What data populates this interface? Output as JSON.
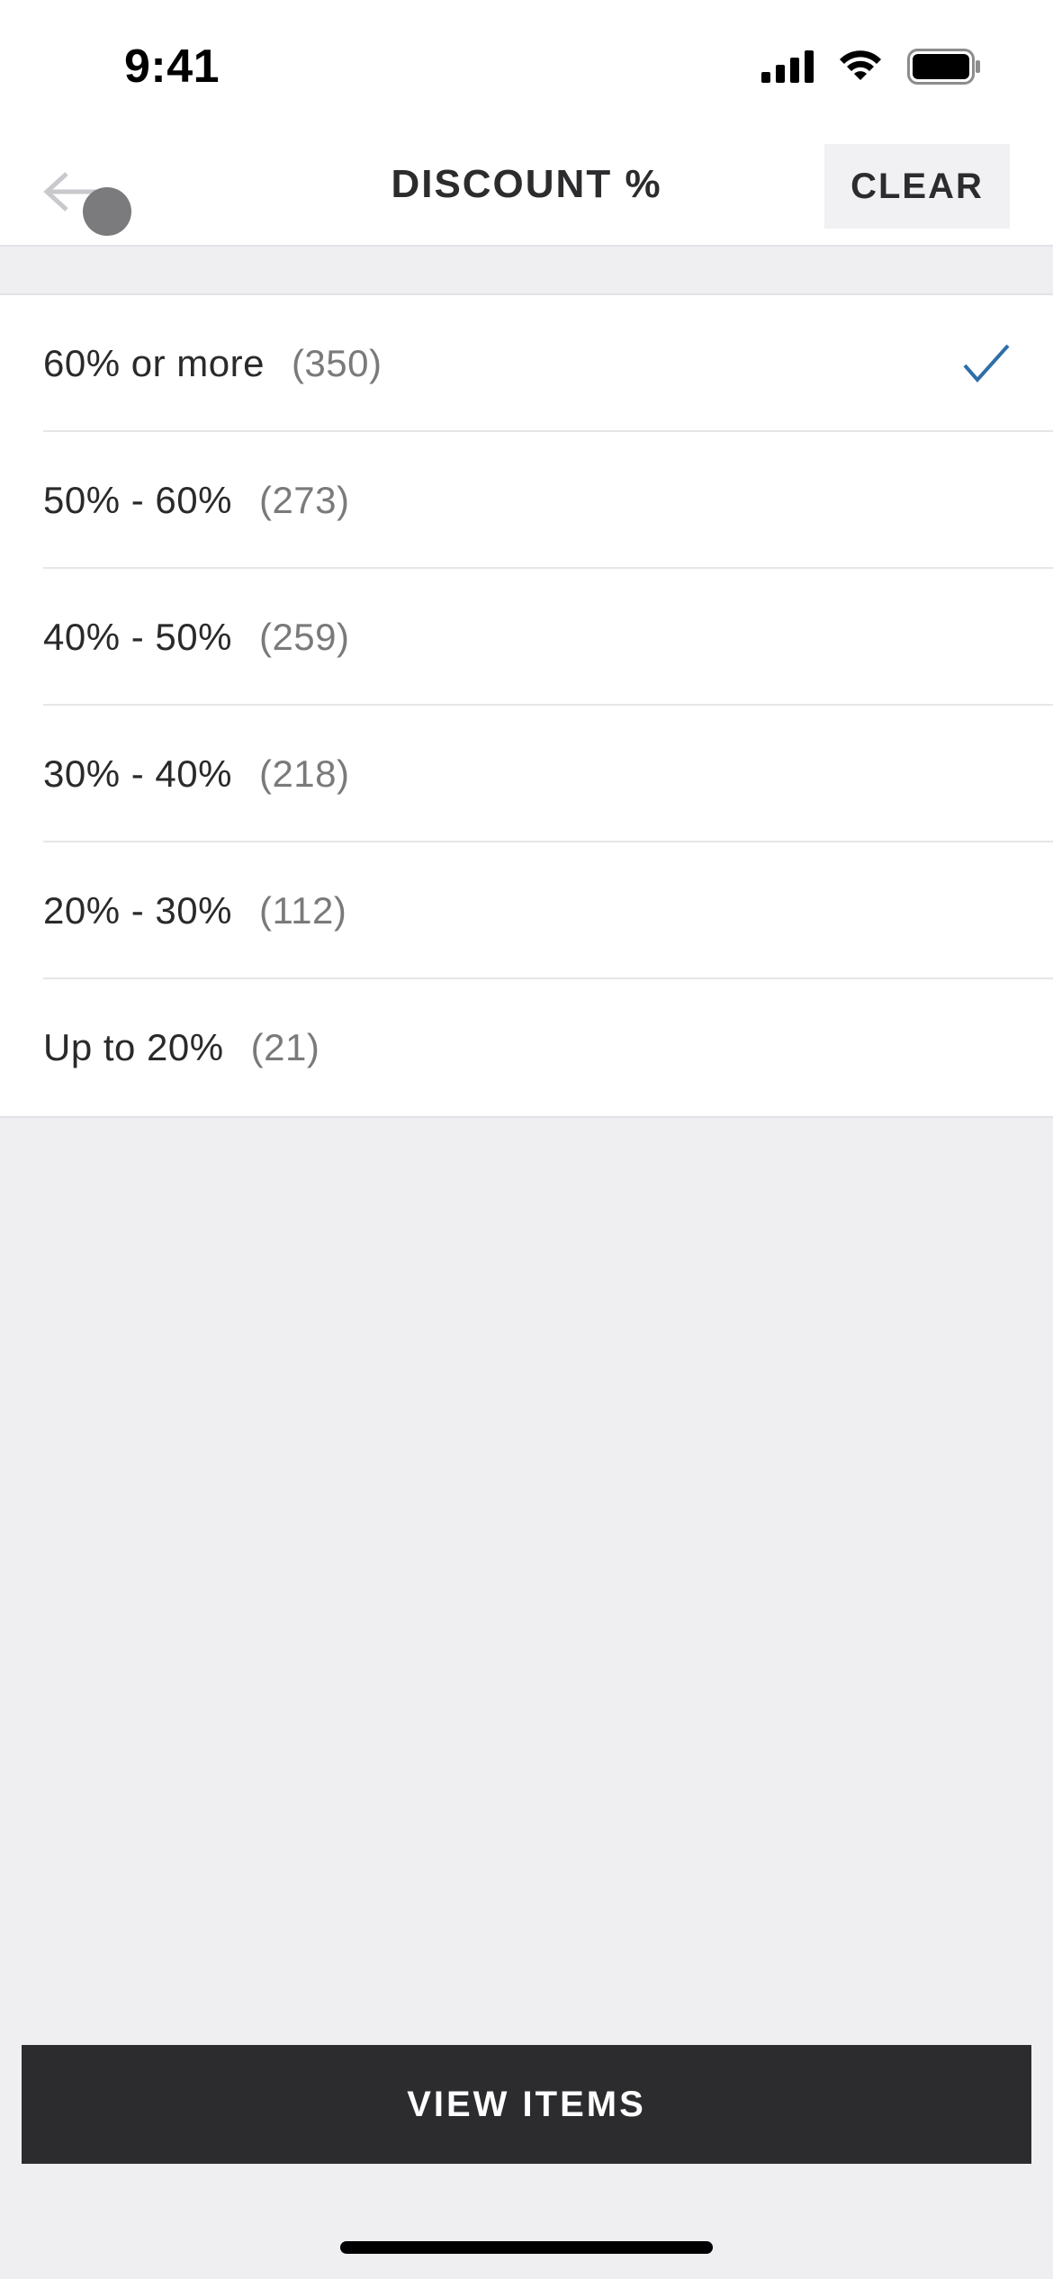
{
  "status_bar": {
    "time": "9:41"
  },
  "header": {
    "title": "DISCOUNT %",
    "clear_label": "CLEAR",
    "back_icon": "arrow-left-icon"
  },
  "options": [
    {
      "label": "60% or more",
      "count": "(350)",
      "selected": true
    },
    {
      "label": "50% - 60%",
      "count": "(273)",
      "selected": false
    },
    {
      "label": "40% - 50%",
      "count": "(259)",
      "selected": false
    },
    {
      "label": "30% - 40%",
      "count": "(218)",
      "selected": false
    },
    {
      "label": "20% - 30%",
      "count": "(112)",
      "selected": false
    },
    {
      "label": "Up to 20%",
      "count": "(21)",
      "selected": false
    }
  ],
  "footer": {
    "view_items_label": "VIEW ITEMS"
  },
  "colors": {
    "accent_check": "#2f6fa7",
    "button_dark": "#2c2b2e",
    "background": "#efeef1"
  }
}
